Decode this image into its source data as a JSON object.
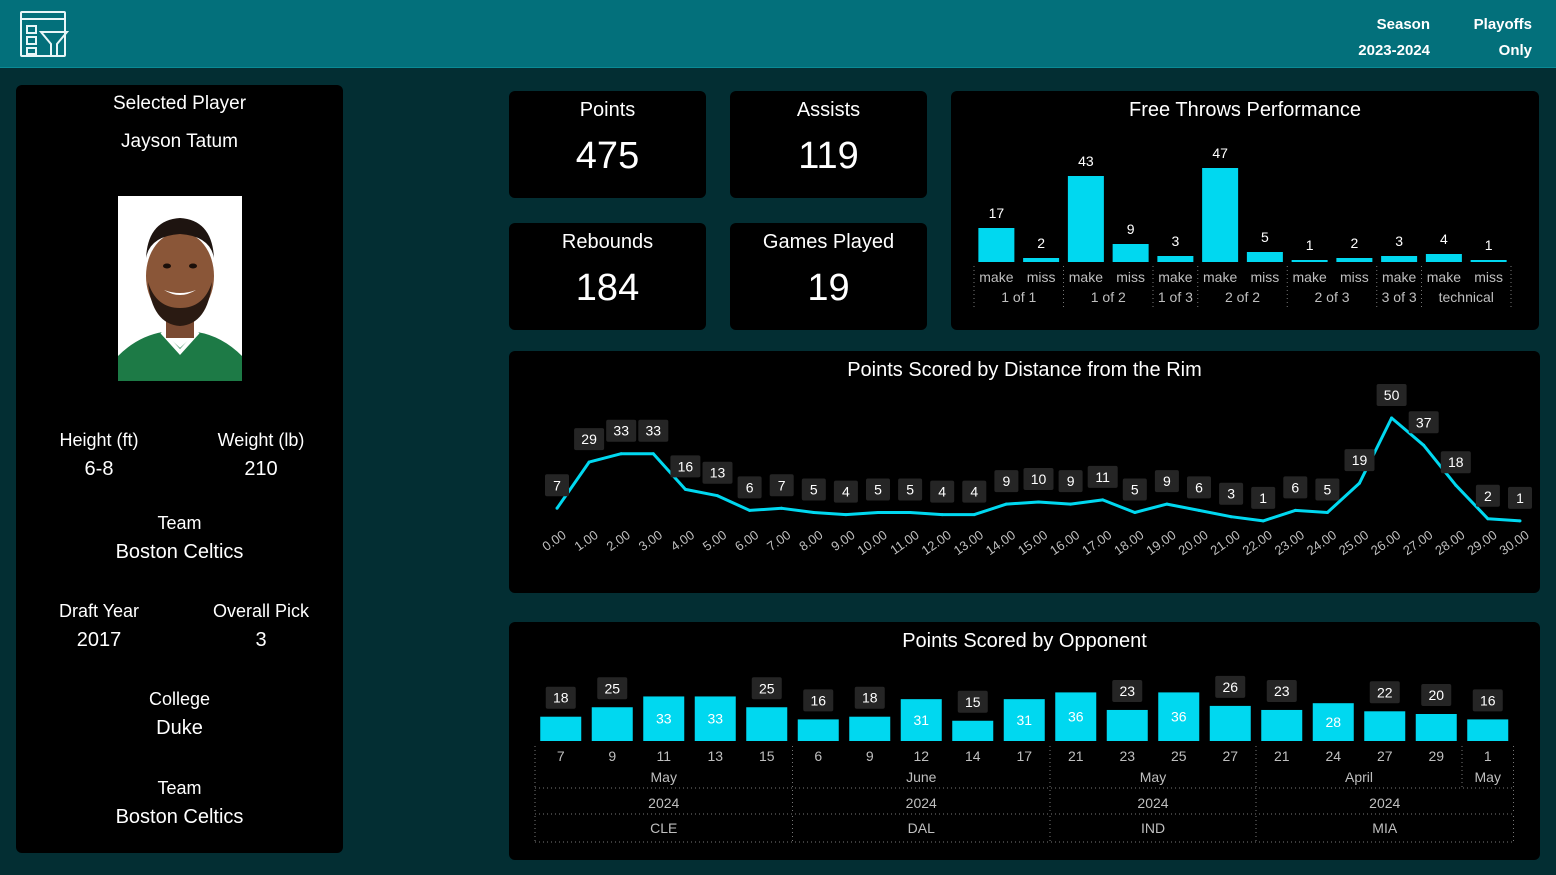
{
  "header": {
    "season_label": "Season",
    "season_value": "2023-2024",
    "playoffs_label": "Playoffs",
    "playoffs_value": "Only",
    "logo_icon": "filter-report-icon"
  },
  "colors": {
    "accent": "#00d8f0",
    "header_bg": "#03707b",
    "page_bg": "#032e33",
    "card_bg": "#000000"
  },
  "player": {
    "panel_title": "Selected Player",
    "name": "Jayson Tatum",
    "height_label": "Height (ft)",
    "height_value": "6-8",
    "weight_label": "Weight (lb)",
    "weight_value": "210",
    "team_label": "Team",
    "team_value": "Boston Celtics",
    "draft_year_label": "Draft Year",
    "draft_year_value": "2017",
    "overall_pick_label": "Overall Pick",
    "overall_pick_value": "3",
    "college_label": "College",
    "college_value": "Duke",
    "team2_label": "Team",
    "team2_value": "Boston Celtics"
  },
  "kpis": {
    "points_label": "Points",
    "points_value": "475",
    "assists_label": "Assists",
    "assists_value": "119",
    "rebounds_label": "Rebounds",
    "rebounds_value": "184",
    "games_label": "Games Played",
    "games_value": "19"
  },
  "chart_data": [
    {
      "type": "bar",
      "title": "Free Throws Performance",
      "categories": [
        "make",
        "miss",
        "make",
        "miss",
        "make",
        "make",
        "miss",
        "make",
        "miss",
        "make",
        "make",
        "miss"
      ],
      "groups": [
        {
          "label": "1 of 1",
          "count": 2
        },
        {
          "label": "1 of 2",
          "count": 2
        },
        {
          "label": "1 of 3",
          "count": 1
        },
        {
          "label": "2 of 2",
          "count": 2
        },
        {
          "label": "2 of 3",
          "count": 2
        },
        {
          "label": "3 of 3",
          "count": 1
        },
        {
          "label": "technical",
          "count": 2
        }
      ],
      "values": [
        17,
        2,
        43,
        9,
        3,
        47,
        5,
        1,
        2,
        3,
        4,
        1
      ]
    },
    {
      "type": "line",
      "title": "Points Scored by Distance from the Rim",
      "x": [
        "0.00",
        "1.00",
        "2.00",
        "3.00",
        "4.00",
        "5.00",
        "6.00",
        "7.00",
        "8.00",
        "9.00",
        "10.00",
        "11.00",
        "12.00",
        "13.00",
        "14.00",
        "15.00",
        "16.00",
        "17.00",
        "18.00",
        "19.00",
        "20.00",
        "21.00",
        "22.00",
        "23.00",
        "24.00",
        "25.00",
        "26.00",
        "27.00",
        "28.00",
        "29.00",
        "30.00"
      ],
      "values": [
        7,
        29,
        33,
        33,
        16,
        13,
        6,
        7,
        5,
        4,
        5,
        5,
        4,
        4,
        9,
        10,
        9,
        11,
        5,
        9,
        6,
        3,
        1,
        6,
        5,
        19,
        50,
        37,
        18,
        2,
        1
      ]
    },
    {
      "type": "bar",
      "title": "Points Scored by Opponent",
      "categories": [
        "7",
        "9",
        "11",
        "13",
        "15",
        "6",
        "9",
        "12",
        "14",
        "17",
        "21",
        "23",
        "25",
        "27",
        "21",
        "24",
        "27",
        "29",
        "1"
      ],
      "values": [
        18,
        25,
        33,
        33,
        25,
        16,
        18,
        31,
        15,
        31,
        36,
        23,
        36,
        26,
        23,
        28,
        22,
        20,
        16
      ],
      "month_groups": [
        {
          "label": "May",
          "count": 5
        },
        {
          "label": "June",
          "count": 5
        },
        {
          "label": "May",
          "count": 4
        },
        {
          "label": "April",
          "count": 4
        },
        {
          "label": "May",
          "count": 1
        }
      ],
      "year_groups": [
        {
          "label": "2024",
          "count": 5
        },
        {
          "label": "2024",
          "count": 5
        },
        {
          "label": "2024",
          "count": 4
        },
        {
          "label": "2024",
          "count": 5
        }
      ],
      "opponent_groups": [
        {
          "label": "CLE",
          "count": 5
        },
        {
          "label": "DAL",
          "count": 5
        },
        {
          "label": "IND",
          "count": 4
        },
        {
          "label": "MIA",
          "count": 5
        }
      ]
    }
  ]
}
